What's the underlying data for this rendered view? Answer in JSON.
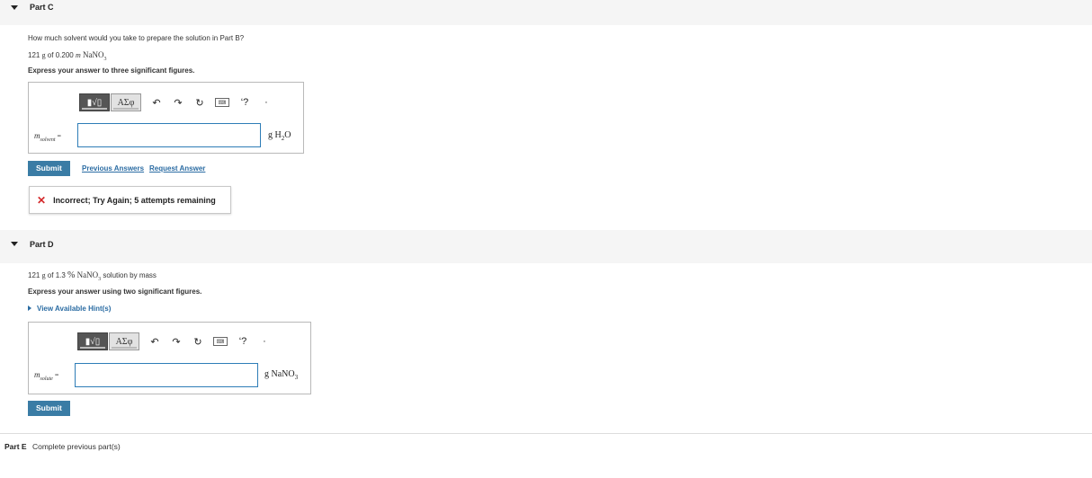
{
  "part_c": {
    "label": "Part C",
    "question": "How much solvent would you take to prepare the solution in Part B?",
    "given_prefix": "121 ",
    "given_unit": "g",
    "given_mid": " of 0.200 ",
    "given_m": "m",
    "given_formula": "NaNO",
    "given_formula_sub": "3",
    "instruction": "Express your answer to three significant figures.",
    "var_symbol": "m",
    "var_sub": "solvent",
    "var_eq": "=",
    "input_value": "",
    "unit_prefix": "g H",
    "unit_sub": "2",
    "unit_suffix": "O",
    "submit_label": "Submit",
    "previous_answers_label": "Previous Answers",
    "request_answer_label": "Request Answer",
    "feedback_icon": "✕",
    "feedback_text": "Incorrect; Try Again; 5 attempts remaining"
  },
  "part_d": {
    "label": "Part D",
    "given_prefix": "121 ",
    "given_unit": "g",
    "given_mid": " of 1.3 ",
    "given_percent": "%",
    "given_formula": "NaNO",
    "given_formula_sub": "3",
    "given_suffix": " solution by mass",
    "instruction": "Express your answer using two significant figures.",
    "hint_label": "View Available Hint(s)",
    "var_symbol": "m",
    "var_sub": "solute",
    "var_eq": "=",
    "input_value": "",
    "unit_prefix": "g NaNO",
    "unit_sub": "3",
    "submit_label": "Submit"
  },
  "toolbar": {
    "template_label": "▮√▯",
    "greek_label": "ΑΣφ",
    "undo": "↶",
    "redo": "↷",
    "reset": "↻",
    "keyboard": "⌨",
    "help": "‘?",
    "more": "·"
  },
  "part_e": {
    "label": "Part E",
    "status": "Complete previous part(s)"
  }
}
